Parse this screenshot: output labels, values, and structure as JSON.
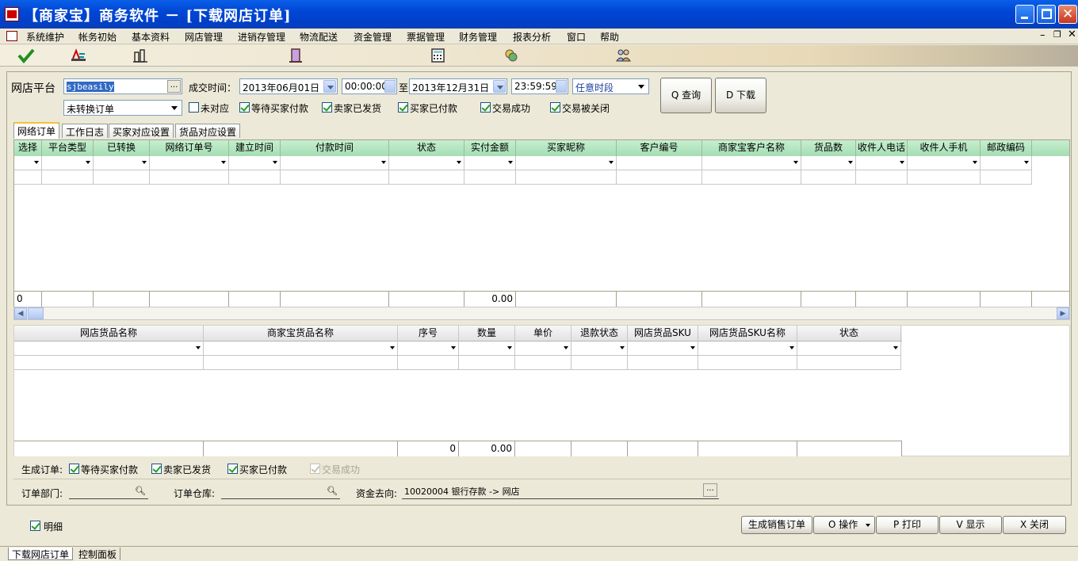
{
  "window": {
    "title": "【商家宝】商务软件 － [下载网店订单]"
  },
  "menu": [
    "系统维护",
    "帐务初始",
    "基本资料",
    "网店管理",
    "进销存管理",
    "物流配送",
    "资金管理",
    "票据管理",
    "财务管理",
    "报表分析",
    "窗口",
    "帮助"
  ],
  "toolbar_icons": [
    "checkmark-icon",
    "chart-icon",
    "report-icon",
    "door-icon",
    "calculator-icon",
    "money-icon",
    "users-icon"
  ],
  "filters": {
    "platform_label": "网店平台",
    "platform_value": "sjbeasily",
    "ellipsis": "...",
    "deal_time_label": "成交时间：",
    "date_from": "2013年06月01日",
    "time_from": "00:00:00",
    "to_label": "至",
    "date_to": "2013年12月31日",
    "time_to": "23:59:59",
    "period": "任意时段",
    "convert_status": "未转换订单",
    "checks": [
      {
        "label": "未对应",
        "checked": false
      },
      {
        "label": "等待买家付款",
        "checked": true
      },
      {
        "label": "卖家已发货",
        "checked": true
      },
      {
        "label": "买家已付款",
        "checked": true
      },
      {
        "label": "交易成功",
        "checked": true
      },
      {
        "label": "交易被关闭",
        "checked": true
      }
    ],
    "query_button": "Q 查询",
    "download_button": "D 下载"
  },
  "tabs": [
    "网络订单",
    "工作日志",
    "买家对应设置",
    "货品对应设置"
  ],
  "orders_grid": {
    "columns": [
      "选择",
      "平台类型",
      "已转换",
      "网络订单号",
      "建立时间",
      "付款时间",
      "状态",
      "实付金额",
      "买家昵称",
      "客户编号",
      "商家宝客户名称",
      "货品数",
      "收件人电话",
      "收件人手机",
      "邮政编码"
    ],
    "footer_count": "0",
    "footer_amount": "0.00"
  },
  "items_grid": {
    "columns": [
      "网店货品名称",
      "商家宝货品名称",
      "序号",
      "数量",
      "单价",
      "退款状态",
      "网店货品SKU",
      "网店货品SKU名称",
      "状态"
    ],
    "footer_qty": "0",
    "footer_price": "0.00"
  },
  "generate": {
    "label": "生成订单:",
    "checks": [
      {
        "label": "等待买家付款",
        "checked": true,
        "disabled": false
      },
      {
        "label": "卖家已发货",
        "checked": true,
        "disabled": false
      },
      {
        "label": "买家已付款",
        "checked": true,
        "disabled": false
      },
      {
        "label": "交易成功",
        "checked": true,
        "disabled": true
      }
    ],
    "dept_label": "订单部门:",
    "warehouse_label": "订单仓库:",
    "funds_label": "资金去向:",
    "funds_value": "10020004 银行存款 -> 网店"
  },
  "bottom": {
    "detail_label": "明细",
    "detail_checked": true,
    "buttons": [
      "生成销售订单",
      "O 操作",
      "P 打印",
      "V 显示",
      "X 关闭"
    ]
  },
  "status_tabs": [
    "下载网店订单",
    "控制面板"
  ]
}
